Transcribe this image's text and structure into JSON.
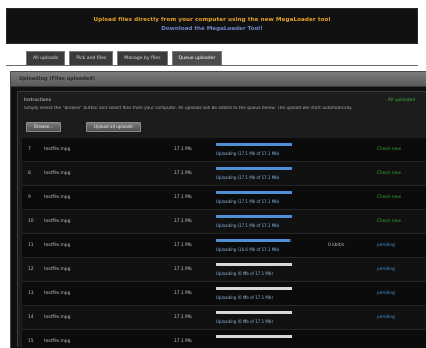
{
  "banner": {
    "line1": "Upload files directly from your computer using the new MegaLoader tool",
    "line2": "Download the MegaLoader Tool!"
  },
  "tabs": [
    {
      "label": "All uploads",
      "active": false
    },
    {
      "label": "Pick and files",
      "active": false
    },
    {
      "label": "Manage by files",
      "active": false
    },
    {
      "label": "Queue uploader",
      "active": true
    }
  ],
  "panel": {
    "title": "Uploading (Files uploaded)",
    "section_title": "Instructions",
    "status_text": "All uploaded",
    "instructions": "Simply select the \"Browse\" button and select files from your computer. All uploads will be added to the queue below. The upload will start automatically.",
    "browse_label": "Browse...",
    "upload_label": "Upload all uploads"
  },
  "colors": {
    "banner_text": "#e8a526",
    "banner_link": "#6f86c8",
    "progress_fill": "#4f8fd6",
    "status_done": "#35a535",
    "status_pending": "#4a8fd0"
  },
  "rows": [
    {
      "num": "7",
      "name": "testfile.mpg",
      "size": "17.1 Mb",
      "progress": 1.0,
      "progress_text": "Uploading (17.1 Mb of 17.1 Mb)",
      "speed": "",
      "status": "Check new",
      "status_kind": "done"
    },
    {
      "num": "8",
      "name": "testfile.mpg",
      "size": "17.1 Mb",
      "progress": 1.0,
      "progress_text": "Uploading (17.1 Mb of 17.1 Mb)",
      "speed": "",
      "status": "Check new",
      "status_kind": "done"
    },
    {
      "num": "9",
      "name": "testfile.mpg",
      "size": "17.1 Mb",
      "progress": 1.0,
      "progress_text": "Uploading (17.1 Mb of 17.1 Mb)",
      "speed": "",
      "status": "Check new",
      "status_kind": "done"
    },
    {
      "num": "10",
      "name": "testfile.mpg",
      "size": "17.1 Mb",
      "progress": 1.0,
      "progress_text": "Uploading (17.1 Mb of 17.1 Mb)",
      "speed": "",
      "status": "Check new",
      "status_kind": "done"
    },
    {
      "num": "11",
      "name": "testfile.mpg",
      "size": "17.1 Mb",
      "progress": 0.97,
      "progress_text": "Uploading (16.6 Mb of 17.1 Mb)",
      "speed": "0 kbit/s",
      "status": "pending",
      "status_kind": "pending"
    },
    {
      "num": "12",
      "name": "testfile.mpg",
      "size": "17.1 Mb",
      "progress": 0.0,
      "progress_text": "Uploading (0 Mb of 17.1 Mb)",
      "speed": "",
      "status": "pending",
      "status_kind": "pending"
    },
    {
      "num": "13",
      "name": "testfile.mpg",
      "size": "17.1 Mb",
      "progress": 0.0,
      "progress_text": "Uploading (0 Mb of 17.1 Mb)",
      "speed": "",
      "status": "pending",
      "status_kind": "pending"
    },
    {
      "num": "14",
      "name": "testfile.mpg",
      "size": "17.1 Mb",
      "progress": 0.0,
      "progress_text": "Uploading (0 Mb of 17.1 Mb)",
      "speed": "",
      "status": "pending",
      "status_kind": "pending"
    },
    {
      "num": "15",
      "name": "testfile.mpg",
      "size": "17.1 Mb",
      "progress": 0.0,
      "progress_text": "",
      "speed": "",
      "status": "",
      "status_kind": "pending"
    }
  ]
}
